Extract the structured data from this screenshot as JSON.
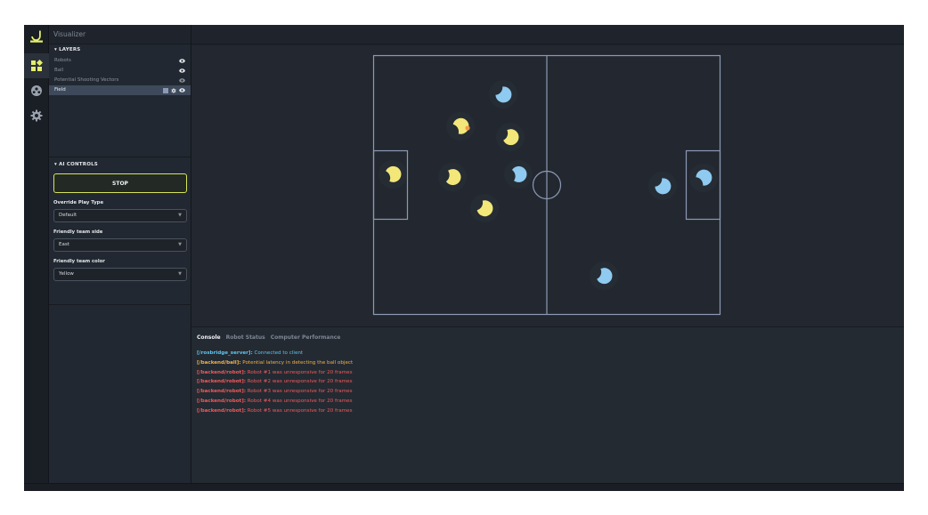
{
  "app": {
    "title": "Visualizer"
  },
  "rail": {
    "icons": [
      "logo-icon",
      "widgets-icon",
      "soccer-ball-icon",
      "gear-icon"
    ]
  },
  "layers": {
    "title": "▾ LAYERS",
    "items": [
      {
        "label": "Robots"
      },
      {
        "label": "Ball"
      },
      {
        "label": "Potential Shooting Vectors"
      },
      {
        "label": "Field"
      }
    ]
  },
  "ai_controls": {
    "title": "▾ AI CONTROLS",
    "stop_label": "STOP",
    "override_play_type_label": "Override Play Type",
    "override_play_type_value": "Default",
    "friendly_team_side_label": "Friendly team side",
    "friendly_team_side_value": "East",
    "friendly_team_color_label": "Friendly team color",
    "friendly_team_color_value": "Yellow"
  },
  "field": {
    "colors": {
      "line": "#8c99b4",
      "yellow": "#f3e779",
      "blue": "#8fcaf0",
      "ball": "#f2994a"
    }
  },
  "console": {
    "tabs": [
      "Console",
      "Robot Status",
      "Computer Performance"
    ],
    "messages": [
      {
        "source": "[/rosbridge_server]:",
        "text": " Connected to client",
        "color": "#5ec4ee"
      },
      {
        "source": "[/backend/ball]:",
        "text": " Potential latency in detecting the ball object",
        "color": "#f0b24b"
      },
      {
        "source": "[/backend/robot]:",
        "text": " Robot #1 was unresponsive for 20 frames",
        "color": "#f05a5a"
      },
      {
        "source": "[/backend/robot]:",
        "text": " Robot #2 was unresponsive for 20 frames",
        "color": "#f05a5a"
      },
      {
        "source": "[/backend/robot]:",
        "text": " Robot #3 was unresponsive for 20 frames",
        "color": "#f05a5a"
      },
      {
        "source": "[/backend/robot]:",
        "text": " Robot #4 was unresponsive for 20 frames",
        "color": "#f05a5a"
      },
      {
        "source": "[/backend/robot]:",
        "text": " Robot #5 was unresponsive for 20 frames",
        "color": "#f05a5a"
      }
    ]
  }
}
